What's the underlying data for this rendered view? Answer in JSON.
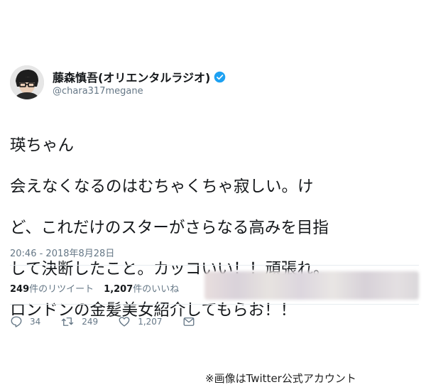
{
  "tweet": {
    "display_name": "藤森慎吾(オリエンタルラジオ)",
    "handle": "@chara317megane",
    "text_lines": [
      "瑛ちゃん",
      "会えなくなるのはむちゃくちゃ寂しい。け",
      "ど、これだけのスターがさらなる高みを目指",
      "して決断したこと。カッコいい！！頑張れ。",
      "ロンドンの金髪美女紹介してもらお！！"
    ],
    "timestamp": "20:46 - 2018年8月28日"
  },
  "stats": {
    "retweet_count": "249",
    "retweet_label": "件のリツイート",
    "like_count": "1,207",
    "like_label": "件のいいね"
  },
  "actions": {
    "reply_count": "34",
    "retweet_count": "249",
    "like_count": "1,207"
  },
  "caption": "※画像はTwitter公式アカウント",
  "colors": {
    "verified": "#1da1f2",
    "muted": "#657786",
    "text": "#14171a"
  },
  "icons": [
    "verified-badge-icon",
    "reply-icon",
    "retweet-icon",
    "like-icon",
    "direct-message-icon"
  ]
}
